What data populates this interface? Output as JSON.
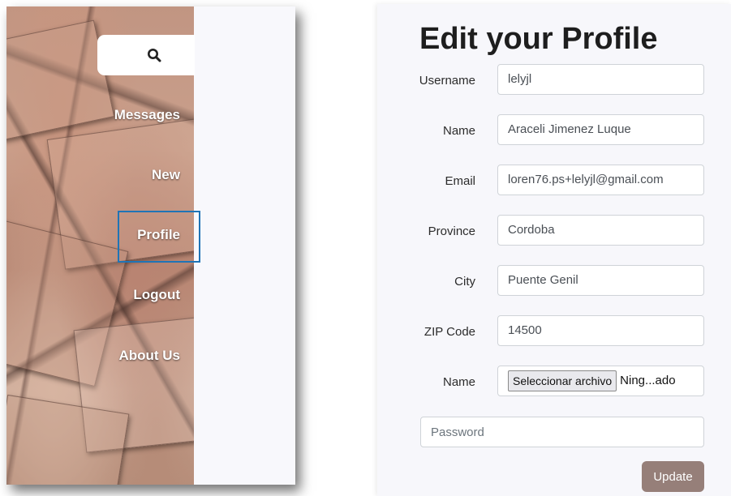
{
  "sidebar": {
    "nav_items": [
      {
        "label": "Messages"
      },
      {
        "label": "New"
      },
      {
        "label": "Profile"
      },
      {
        "label": "Logout"
      },
      {
        "label": "About Us"
      }
    ],
    "active_item": "Profile",
    "search_icon": "search-icon",
    "highlight_color": "#1f74b6"
  },
  "form": {
    "title": "Edit your Profile",
    "fields": [
      {
        "label": "Username",
        "value": "lelyjl"
      },
      {
        "label": "Name",
        "value": "Araceli Jimenez Luque"
      },
      {
        "label": "Email",
        "value": "loren76.ps+lelyjl@gmail.com"
      },
      {
        "label": "Province",
        "value": "Cordoba"
      },
      {
        "label": "City",
        "value": "Puente Genil"
      },
      {
        "label": "ZIP Code",
        "value": "14500"
      }
    ],
    "file_field": {
      "label": "Name",
      "button_label": "Seleccionar archivo",
      "status": "Ning...ado"
    },
    "password_placeholder": "Password",
    "update_label": "Update",
    "update_color": "#967f79"
  }
}
